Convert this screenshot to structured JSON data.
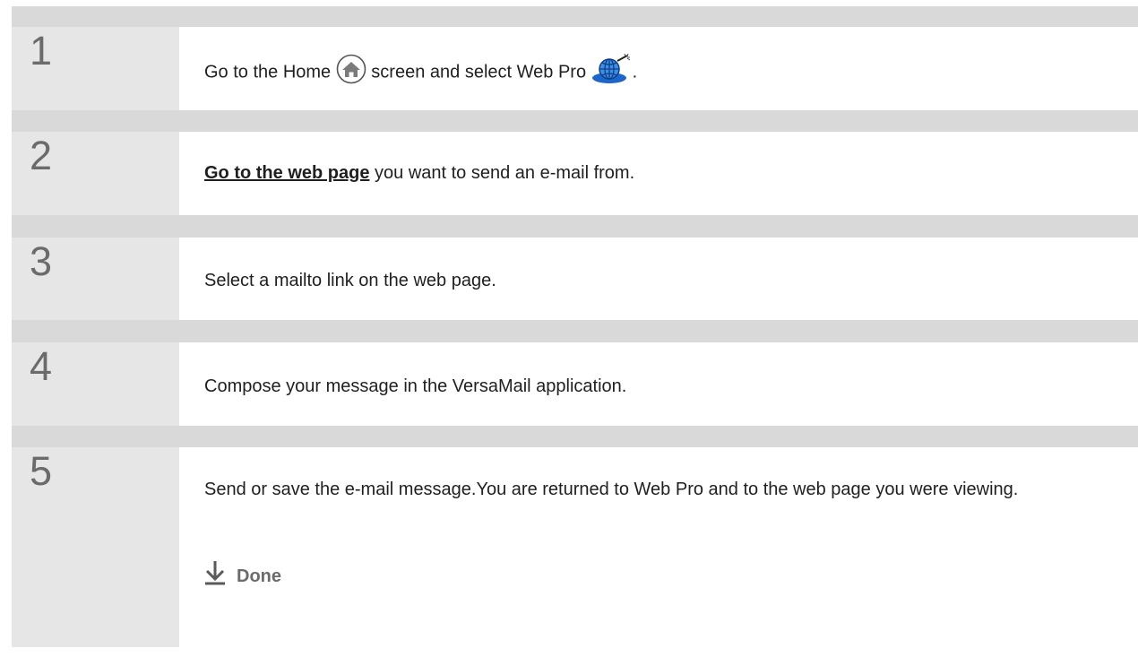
{
  "steps": [
    {
      "number": "1",
      "before": "Go to the Home ",
      "home_icon": "home-icon",
      "middle": " screen and select Web Pro ",
      "webpro_icon": "globe-icon",
      "after": "."
    },
    {
      "number": "2",
      "link": "Go to the web page",
      "rest": " you want to send an e-mail from."
    },
    {
      "number": "3",
      "text": "Select a mailto link on the web page."
    },
    {
      "number": "4",
      "text": "Compose your message in the VersaMail application."
    },
    {
      "number": "5",
      "text": "Send or save the e-mail message.You are returned to Web Pro and to the web page you were viewing.",
      "done_label": "Done",
      "done_icon": "arrow-down-icon"
    }
  ],
  "colors": {
    "background": "#d9d9d9",
    "number_column": "#e6e6e6",
    "content": "#ffffff",
    "number_text": "#6b6b6b",
    "body_text": "#1f1f1f"
  }
}
